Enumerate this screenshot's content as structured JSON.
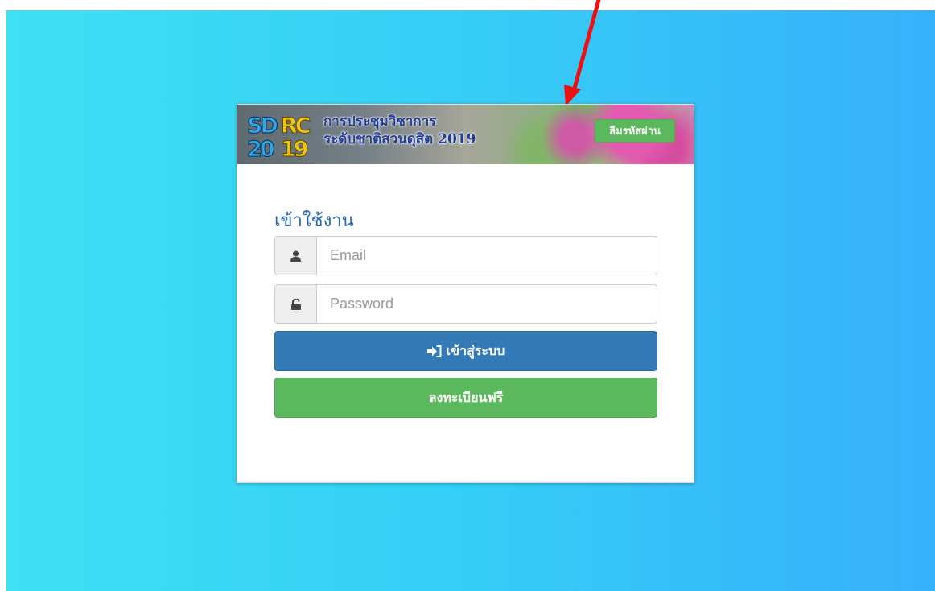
{
  "banner": {
    "logo_text": [
      "SDRC",
      "2019"
    ],
    "title_line1": "การประชุมวิชาการ",
    "title_line2": "ระดับชาติสวนดุสิต 2019",
    "forgot_password_label": "ลืมรหัสผ่าน"
  },
  "form": {
    "heading": "เข้าใช้งาน",
    "email_placeholder": "Email",
    "password_placeholder": "Password",
    "login_label": "เข้าสู่ระบบ",
    "register_label": "ลงทะเบียนฟรี"
  },
  "icons": {
    "email": "user-icon",
    "password": "unlock-icon",
    "login": "sign-in-icon",
    "annotation": "red-arrow-icon"
  },
  "colors": {
    "background_gradient": [
      "#3fe0f3",
      "#37b0fb"
    ],
    "primary": "#337ab7",
    "success": "#5cb85c",
    "heading": "#2668b5",
    "annotation_arrow": "#ee1111"
  }
}
